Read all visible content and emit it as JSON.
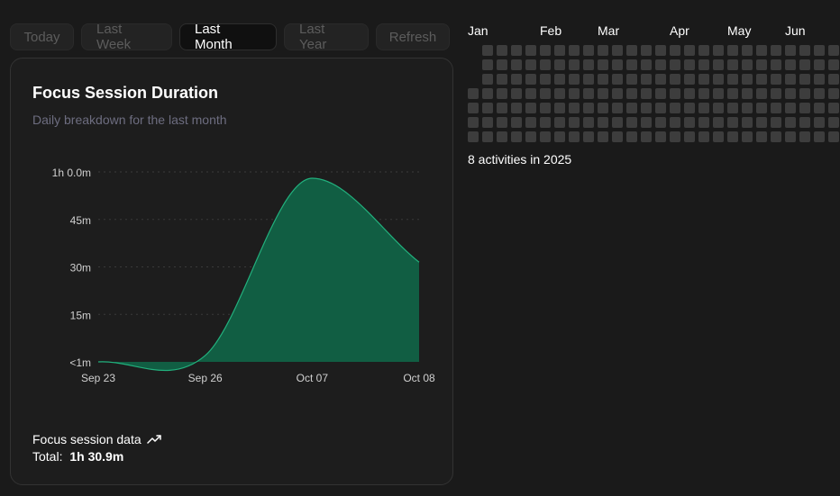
{
  "tabs": {
    "today": "Today",
    "last_week": "Last Week",
    "last_month": "Last Month",
    "last_year": "Last Year",
    "refresh": "Refresh",
    "active": "last_month"
  },
  "card": {
    "title": "Focus Session Duration",
    "subtitle": "Daily breakdown for the last month",
    "footer_title": "Focus session data",
    "footer_icon": "trending-up-icon",
    "total_label": "Total:",
    "total_value": "1h 30.9m"
  },
  "chart_data": {
    "type": "area",
    "title": "Focus Session Duration",
    "subtitle": "Daily breakdown for the last month",
    "x_tick_labels": [
      "Sep 23",
      "Sep 26",
      "Oct 07",
      "Oct 08"
    ],
    "y_tick_labels": [
      "<1m",
      "15m",
      "30m",
      "45m",
      "1h 0.0m"
    ],
    "ylim_minutes": [
      0,
      60
    ],
    "series": [
      {
        "points": [
          {
            "x": "Sep 23",
            "minutes": 0
          },
          {
            "x": "Sep 26",
            "minutes": 2
          },
          {
            "x": "Oct 07",
            "minutes": 58
          },
          {
            "x": "Oct 08",
            "minutes": 31.5
          }
        ]
      }
    ],
    "fill_color": "#115e43",
    "line_color": "#22b07d",
    "grid": "horizontal dashed"
  },
  "heatmap": {
    "months": [
      "Jan",
      "Feb",
      "Mar",
      "Apr",
      "May",
      "Jun"
    ],
    "weeks": 26,
    "days": 7,
    "first_week_missing_days": 3,
    "cell_color": "#3d3d3d",
    "summary": "8 activities in 2025"
  }
}
